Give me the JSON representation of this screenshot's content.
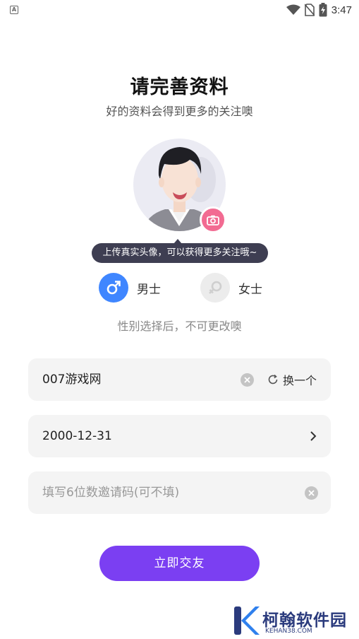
{
  "status_bar": {
    "time": "3:47",
    "app_icon": "A"
  },
  "header": {
    "title": "请完善资料",
    "subtitle": "好的资料会得到更多的关注噢"
  },
  "avatar": {
    "tooltip": "上传真实头像，可以获得更多关注哦~"
  },
  "gender": {
    "male_label": "男士",
    "female_label": "女士",
    "selected": "male",
    "note": "性别选择后，不可更改噢"
  },
  "form": {
    "nickname_value": "007游戏网",
    "swap_label": "换一个",
    "birthday_value": "2000-12-31",
    "invite_placeholder": "填写6位数邀请码(可不填)"
  },
  "submit_label": "立即交友",
  "watermark": {
    "name": "柯翰软件园",
    "url": "KEHAN38.COM"
  },
  "colors": {
    "primary": "#7b3ff2",
    "male": "#3f86ff",
    "camera": "#f26b92",
    "tooltip": "#3e3e52"
  }
}
